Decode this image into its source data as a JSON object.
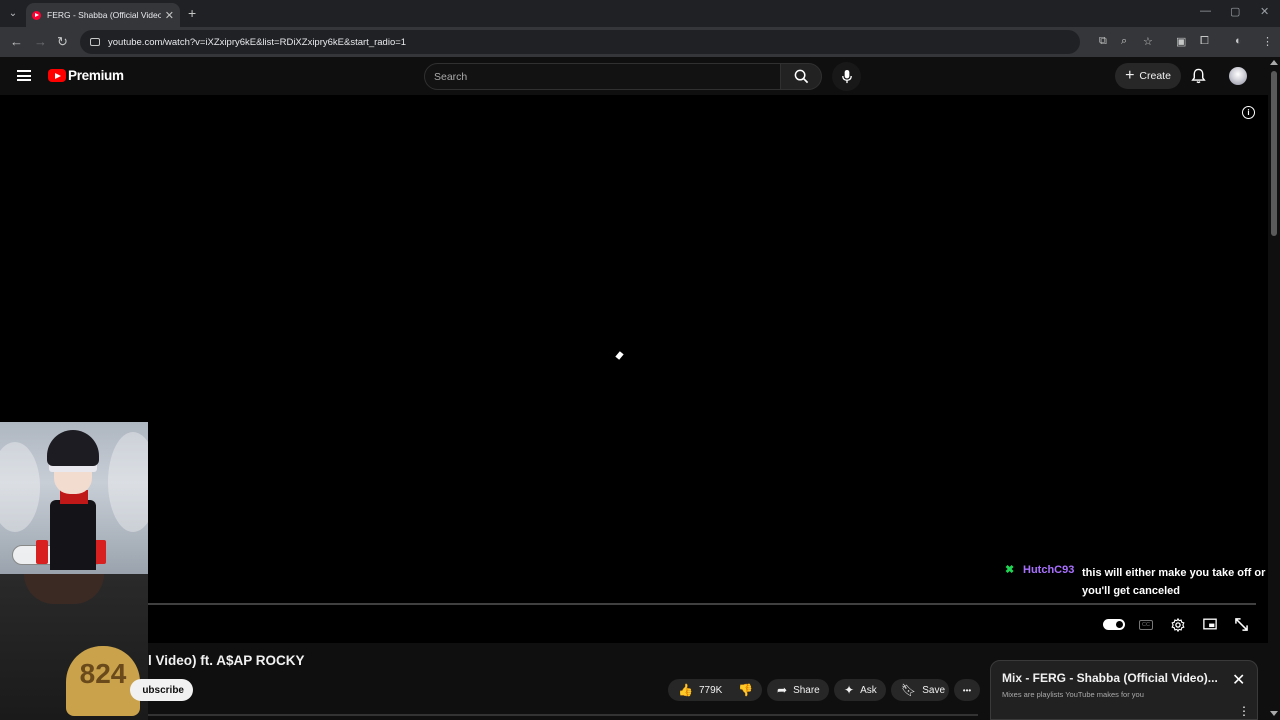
{
  "browser": {
    "tab": {
      "title": "FERG - Shabba (Official Video) f",
      "close": "✕"
    },
    "new_tab": "+",
    "url": "youtube.com/watch?v=iXZxipry6kE&list=RDiXZxipry6kE&start_radio=1",
    "window_controls": [
      "—",
      "▢",
      "✕"
    ]
  },
  "masthead": {
    "brand": "Premium",
    "search": {
      "placeholder": "Search"
    },
    "create_label": "Create"
  },
  "player": {
    "info_glyph": "i"
  },
  "chat": {
    "user": "HutchC93",
    "message": "this will either make you take off or you'll get canceled"
  },
  "webcam": {
    "jersey_number": "824"
  },
  "video": {
    "title_visible": "l Video) ft. A$AP ROCKY",
    "subscribe_label": "ubscribe",
    "likes": "779K",
    "share_label": "Share",
    "ask_label": "Ask",
    "save_label": "Save",
    "more_glyph": "•••"
  },
  "mix": {
    "title": "Mix - FERG - Shabba (Official Video)...",
    "subtitle": "Mixes are playlists YouTube makes for you",
    "close": "✕",
    "more": "⋮"
  },
  "colors": {
    "brand_red": "#ff0000",
    "chat_username": "#a970ff",
    "chat_badge": "#1fd655",
    "background": "#0f0f0f"
  }
}
